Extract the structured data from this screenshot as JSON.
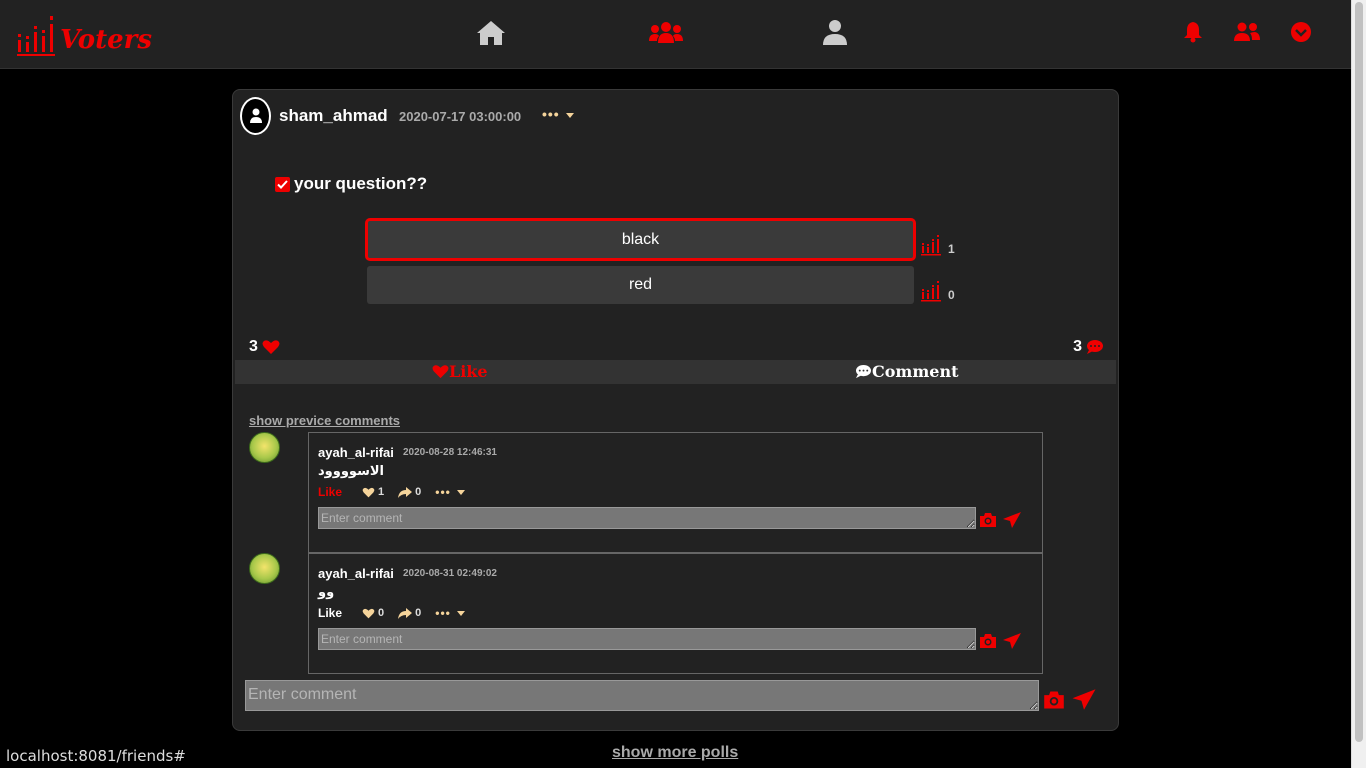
{
  "app": {
    "brand": "Voters"
  },
  "nav": {
    "center": [
      "home-icon",
      "groups-icon",
      "user-icon"
    ],
    "right": [
      "bell-icon",
      "friends-icon",
      "chevron-down-circle-icon"
    ]
  },
  "post": {
    "username": "sham_ahmad",
    "timestamp": "2020-07-17 03:00:00",
    "menu": "•••",
    "question": "your question??",
    "options": [
      {
        "label": "black",
        "votes": "1",
        "selected": true
      },
      {
        "label": "red",
        "votes": "0",
        "selected": false
      }
    ],
    "likes_count": "3",
    "comments_count": "3",
    "like_label": "Like",
    "comment_label": "Comment",
    "show_previous": "show previce comments",
    "comment_placeholder": "Enter comment"
  },
  "comments": [
    {
      "username": "ayah_al-rifai",
      "timestamp": "2020-08-28 12:46:31",
      "text": "الاسوووود",
      "like_label": "Like",
      "like_active": true,
      "likes": "1",
      "shares": "0",
      "menu": "•••",
      "reply_placeholder": "Enter comment"
    },
    {
      "username": "ayah_al-rifai",
      "timestamp": "2020-08-31 02:49:02",
      "text": "وو",
      "like_label": "Like",
      "like_active": false,
      "likes": "0",
      "shares": "0",
      "menu": "•••",
      "reply_placeholder": "Enter comment"
    }
  ],
  "footer": {
    "show_more": "show more polls",
    "status_url": "localhost:8081/friends#"
  },
  "colors": {
    "accent": "#ee0000",
    "background": "#000000",
    "card": "#222222",
    "stat": "#f5d49b"
  }
}
